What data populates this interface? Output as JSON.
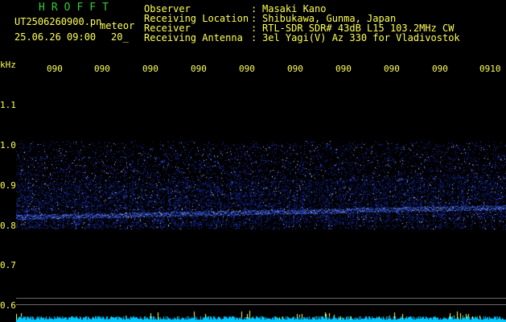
{
  "header": {
    "brand": "HROFFT",
    "filename": "UT2506260900.pn",
    "mode": "meteor",
    "datetime": "25.06.26 09:00",
    "mode_extra": "20_",
    "labels": [
      {
        "key": "Observer",
        "sep": ":",
        "value": "Masaki Kano"
      },
      {
        "key": "Receiving Location",
        "sep": ":",
        "value": "Shibukawa, Gunma, Japan"
      },
      {
        "key": "Receiver",
        "sep": ":",
        "value": "RTL-SDR SDR# 43dB L15 103.2MHz CW"
      },
      {
        "key": "Receiving Antenna",
        "sep": ":",
        "value": "3el Yagi(V) Az 330 for Vladivostok"
      }
    ]
  },
  "axis": {
    "y_unit": "kHz",
    "y_ticks": [
      "1.1",
      "1.0",
      "0.9",
      "0.8",
      "0.7",
      "0.6"
    ],
    "x_ticks": [
      "090",
      "090",
      "090",
      "090",
      "090",
      "090",
      "090",
      "090",
      "090",
      "0910"
    ]
  },
  "colors": {
    "text": "#ffff55",
    "brand": "#33cc33",
    "signal": "#3050ff",
    "background": "#000000",
    "baseline": "#00c8ff"
  }
}
